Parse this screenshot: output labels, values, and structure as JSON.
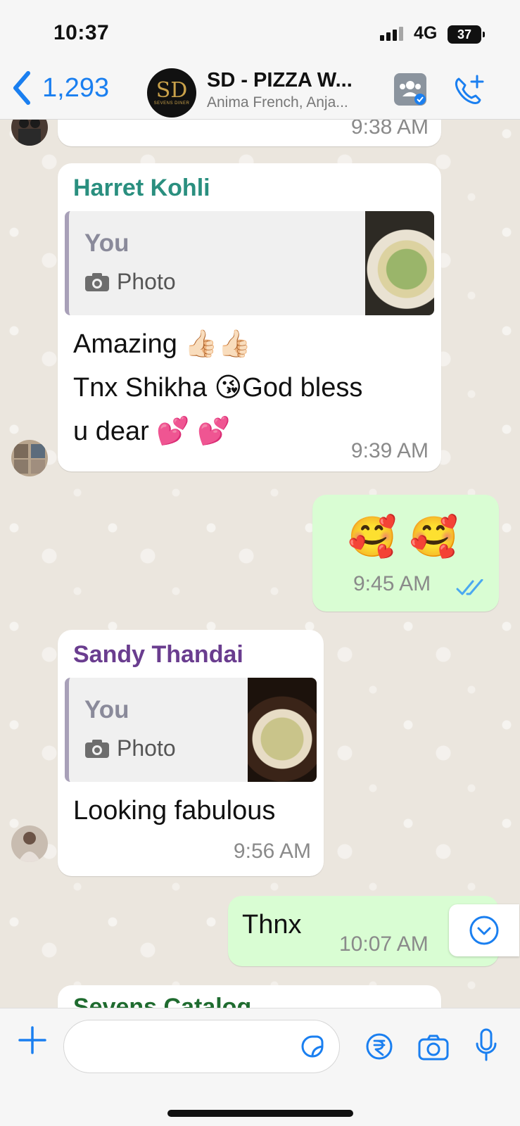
{
  "status_bar": {
    "time": "10:37",
    "network": "4G",
    "battery": "37"
  },
  "header": {
    "back_count": "1,293",
    "group_name": "SD - PIZZA W...",
    "group_members": "Anima French, Anja...",
    "avatar_monogram": "SD",
    "avatar_caption": "SEVENS DINER"
  },
  "messages": [
    {
      "type": "incoming",
      "time": "9:38 AM"
    },
    {
      "type": "incoming",
      "sender": "Harret Kohli",
      "sender_color": "#2a8f7f",
      "quote_author": "You",
      "quote_label": "Photo",
      "lines": [
        "Amazing 👍🏻👍🏻",
        "Tnx Shikha 😘God bless",
        "u dear 💕 💕"
      ],
      "time": "9:39 AM"
    },
    {
      "type": "outgoing",
      "text": "🥰 🥰",
      "time": "9:45 AM",
      "status": "read"
    },
    {
      "type": "incoming",
      "sender": "Sandy Thandai",
      "sender_color": "#6a3d8f",
      "quote_author": "You",
      "quote_label": "Photo",
      "text": "Looking fabulous",
      "time": "9:56 AM"
    },
    {
      "type": "outgoing",
      "text": "Thnx",
      "time": "10:07 AM"
    },
    {
      "type": "incoming",
      "sender": "Sevens Catalog",
      "sender_color": "#1f6b2f"
    }
  ],
  "colors": {
    "accent": "#1a7ff0",
    "outgoing_bubble": "#d9fdd3",
    "incoming_bubble": "#ffffff"
  }
}
